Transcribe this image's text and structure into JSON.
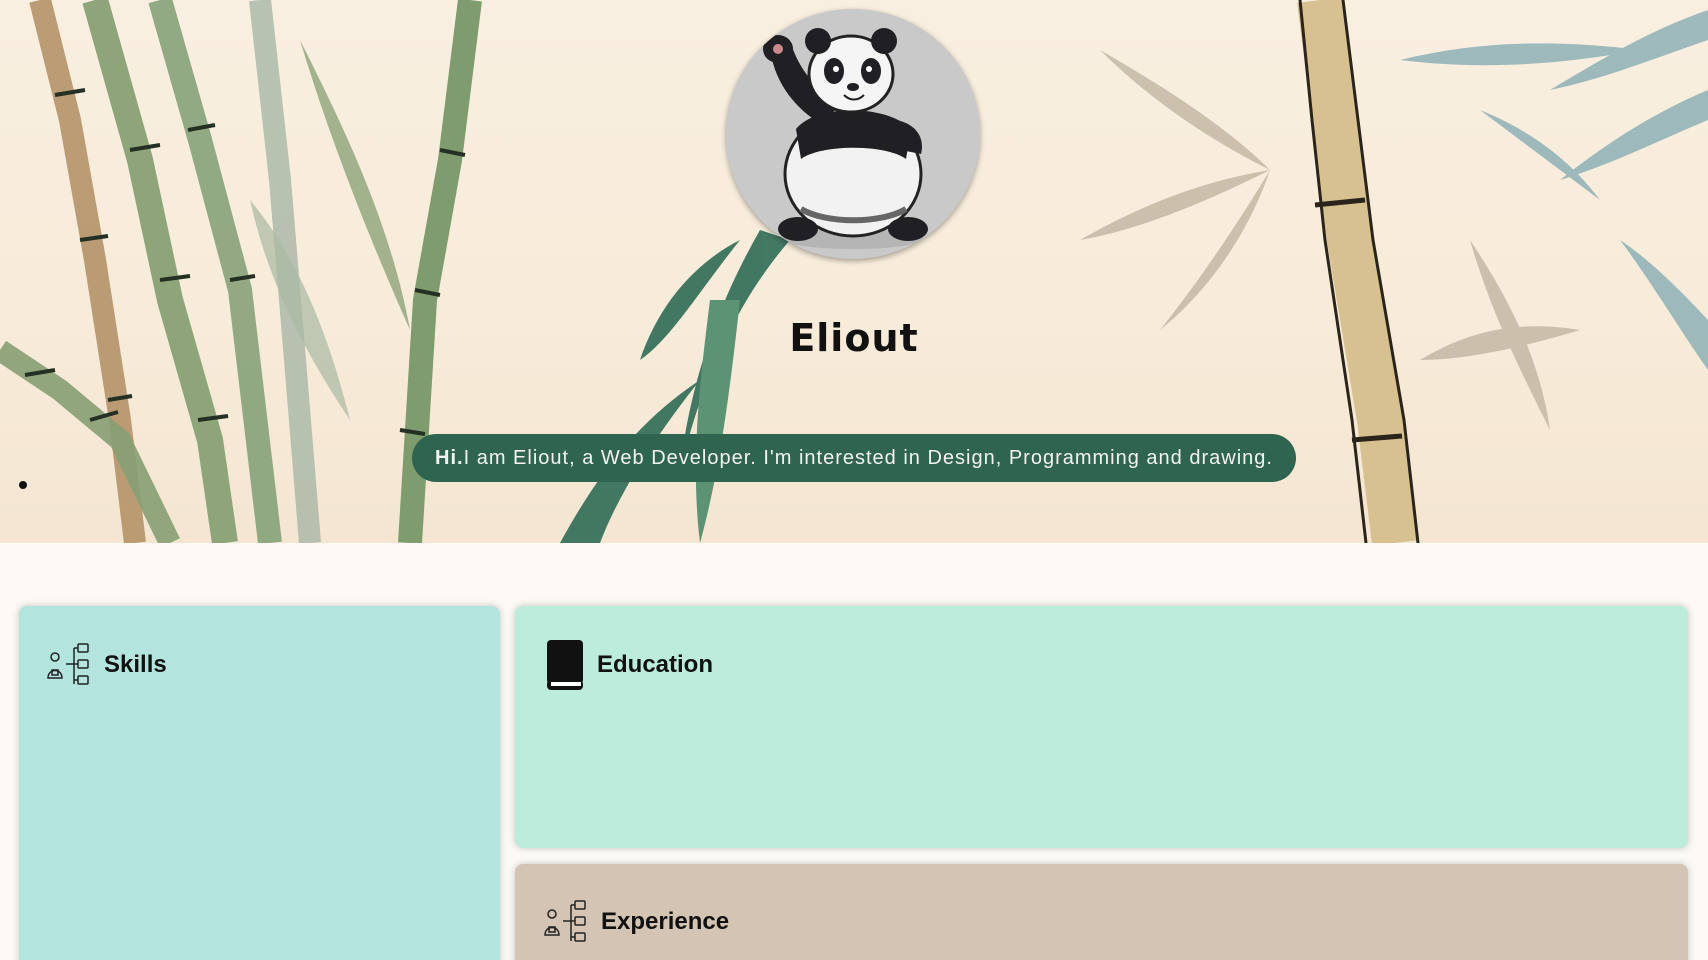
{
  "profile": {
    "name": "Eliout",
    "avatar_icon": "panda-avatar",
    "intro_greeting": "Hi.",
    "intro_text": "I am Eliout, a Web Developer. I'm interested in Design, Programming and drawing."
  },
  "sections": {
    "skills": {
      "title": "Skills",
      "icon": "org-chart-icon"
    },
    "education": {
      "title": "Education",
      "icon": "book-icon"
    },
    "experience": {
      "title": "Experience",
      "icon": "org-chart-icon"
    }
  },
  "colors": {
    "intro_pill": "#2f6550",
    "skills_card": "#b3e5de",
    "education_card": "#bcecdb",
    "experience_card": "#d3c4b3",
    "page_background": "#fdfaf6"
  }
}
